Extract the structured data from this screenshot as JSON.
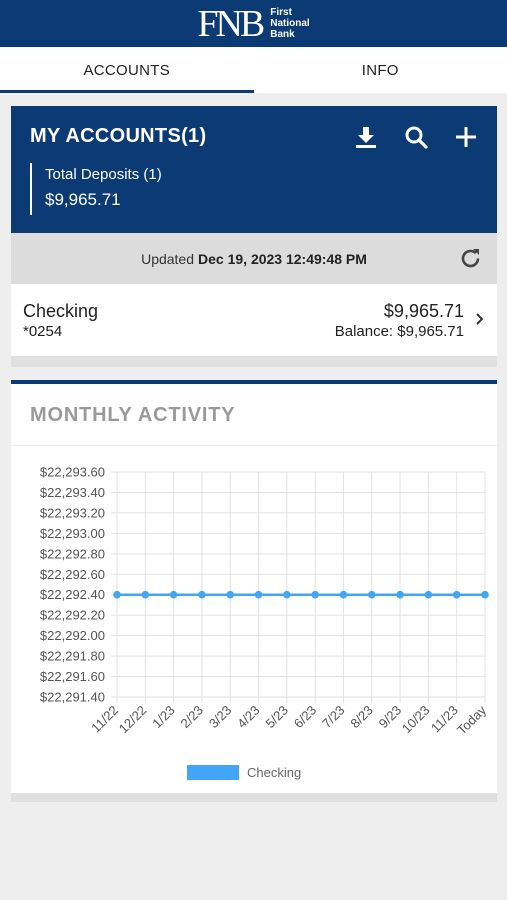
{
  "header": {
    "logo_mark": "FNB",
    "logo_line1": "First",
    "logo_line2": "National",
    "logo_line3": "Bank"
  },
  "tabs": [
    {
      "label": "ACCOUNTS",
      "active": true
    },
    {
      "label": "INFO",
      "active": false
    }
  ],
  "accounts": {
    "title": "MY ACCOUNTS(1)",
    "tools": [
      "download-icon",
      "search-icon",
      "plus-icon"
    ],
    "deposits_label": "Total Deposits (1)",
    "deposits_amount": "$9,965.71",
    "updated_prefix": "Updated",
    "updated_time": "Dec 19, 2023 12:49:48 PM"
  },
  "account_row": {
    "name": "Checking",
    "number": "*0254",
    "amount": "$9,965.71",
    "balance": "Balance: $9,965.71"
  },
  "activity": {
    "title": "MONTHLY ACTIVITY"
  },
  "colors": {
    "brand": "#0b3a75",
    "series": "#42a5f5"
  },
  "chart_data": {
    "type": "line",
    "title": "",
    "xlabel": "",
    "ylabel": "",
    "categories": [
      "11/22",
      "12/22",
      "1/23",
      "2/23",
      "3/23",
      "4/23",
      "5/23",
      "6/23",
      "7/23",
      "8/23",
      "9/23",
      "10/23",
      "11/23",
      "Today"
    ],
    "series": [
      {
        "name": "Checking",
        "values": [
          22292.4,
          22292.4,
          22292.4,
          22292.4,
          22292.4,
          22292.4,
          22292.4,
          22292.4,
          22292.4,
          22292.4,
          22292.4,
          22292.4,
          22292.4,
          22292.4
        ]
      }
    ],
    "yticks": [
      "$22,293.60",
      "$22,293.40",
      "$22,293.20",
      "$22,293.00",
      "$22,292.80",
      "$22,292.60",
      "$22,292.40",
      "$22,292.20",
      "$22,292.00",
      "$22,291.80",
      "$22,291.60",
      "$22,291.40"
    ],
    "ylim": [
      22291.4,
      22293.6
    ],
    "grid": true,
    "legend": "bottom"
  }
}
